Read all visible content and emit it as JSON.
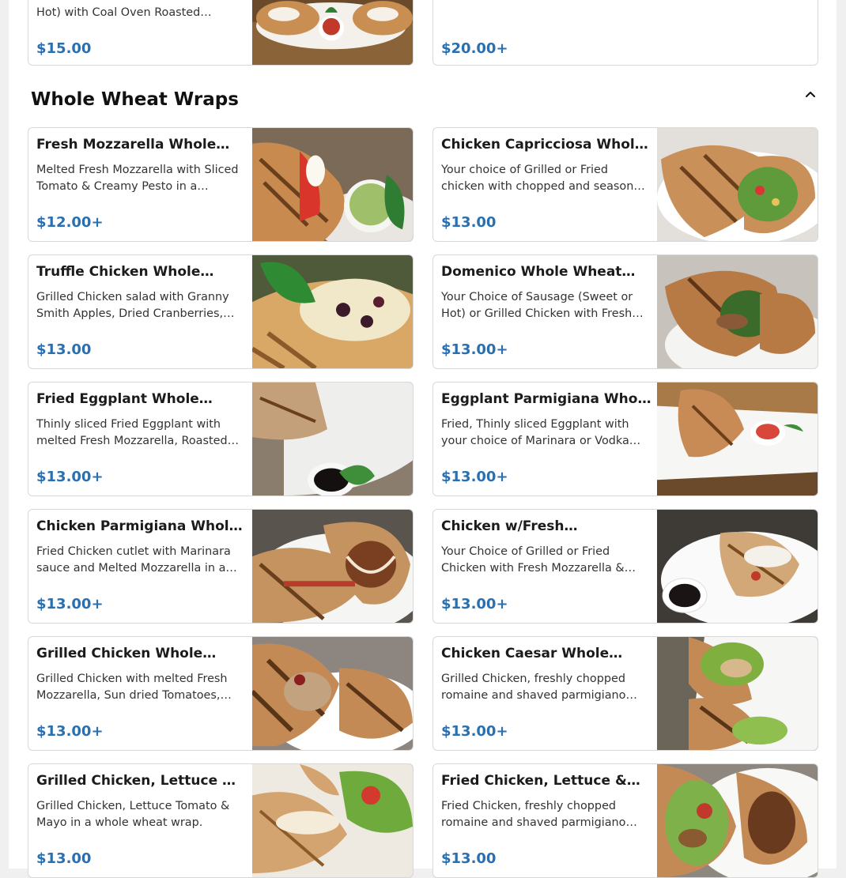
{
  "top_cards": [
    {
      "desc": "Hot) with Coal Oven Roasted…",
      "price": "$15.00"
    },
    {
      "desc": "",
      "price": "$20.00+"
    }
  ],
  "section": {
    "title": "Whole Wheat Wraps",
    "collapse_icon": "chevron-up-icon"
  },
  "items": [
    {
      "title": "Fresh Mozzarella Whole…",
      "desc": "Melted Fresh Mozzarella with Sliced Tomato & Creamy Pesto in a whole…",
      "price": "$12.00+"
    },
    {
      "title": "Chicken Capricciosa Whol…",
      "desc": "Your choice of Grilled or Fried chicken with chopped and seasoned romai…",
      "price": "$13.00"
    },
    {
      "title": "Truffle Chicken Whole…",
      "desc": "Grilled Chicken salad with Granny Smith Apples, Dried Cranberries, R…",
      "price": "$13.00"
    },
    {
      "title": "Domenico Whole Wheat…",
      "desc": "Your Choice of Sausage (Sweet or Hot) or Grilled Chicken with Fresh…",
      "price": "$13.00+"
    },
    {
      "title": "Fried Eggplant Whole…",
      "desc": "Thinly sliced Fried Eggplant with melted Fresh Mozzarella, Roasted…",
      "price": "$13.00+"
    },
    {
      "title": "Eggplant Parmigiana Who…",
      "desc": "Fried, Thinly sliced Eggplant with your choice of Marinara or Vodka…",
      "price": "$13.00+"
    },
    {
      "title": "Chicken Parmigiana Whol…",
      "desc": "Fried Chicken cutlet with Marinara sauce and Melted Mozzarella in a…",
      "price": "$13.00+"
    },
    {
      "title": "Chicken w/Fresh…",
      "desc": "Your Choice of Grilled or Fried Chicken with Fresh Mozzarella &…",
      "price": "$13.00+"
    },
    {
      "title": "Grilled Chicken Whole…",
      "desc": "Grilled Chicken with melted Fresh Mozzarella, Sun dried Tomatoes, Re…",
      "price": "$13.00+"
    },
    {
      "title": "Chicken Caesar Whole…",
      "desc": "Grilled Chicken, freshly chopped romaine and shaved parmigiano…",
      "price": "$13.00+"
    },
    {
      "title": "Grilled Chicken, Lettuce …",
      "desc": "Grilled Chicken, Lettuce Tomato & Mayo in a whole wheat wrap.",
      "price": "$13.00"
    },
    {
      "title": "Fried Chicken, Lettuce &…",
      "desc": "Fried Chicken, freshly chopped romaine and shaved parmigiano…",
      "price": "$13.00"
    }
  ],
  "colors": {
    "price": "#2a6fb0",
    "border": "#d8d8d8",
    "background": "#ffffff"
  }
}
